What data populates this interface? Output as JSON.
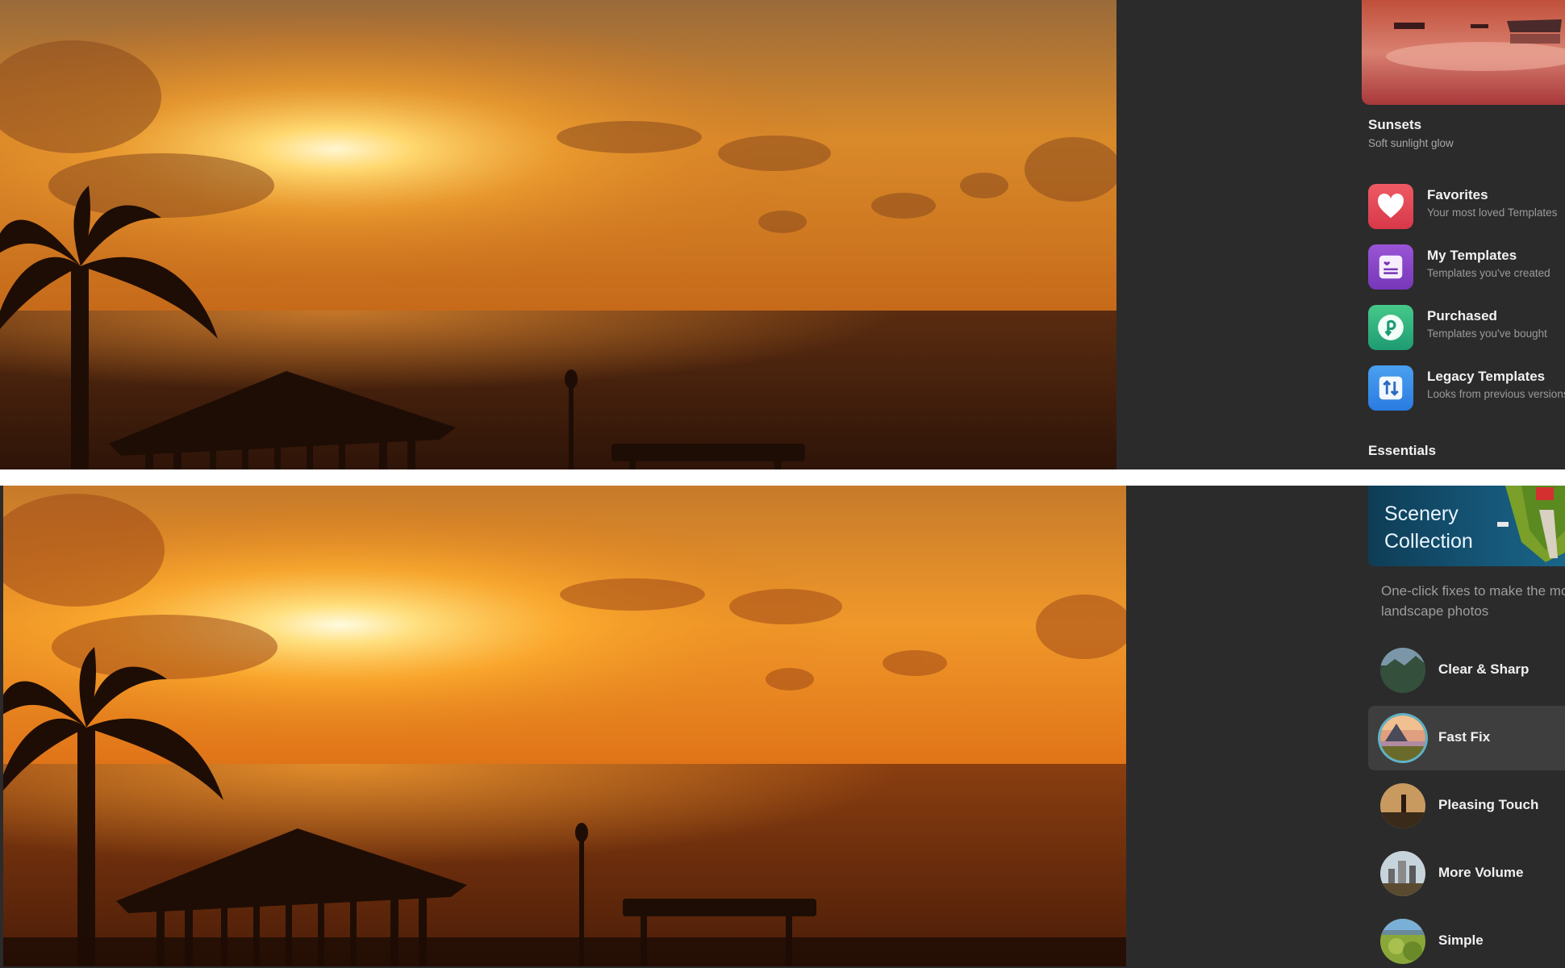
{
  "top_panel": {
    "photo": {
      "description": "Sunset over the sea with palm tree and gazebo silhouettes (before)"
    },
    "sidebar": {
      "featured_card": {
        "title": "Sunsets",
        "subtitle": "Soft sunlight glow"
      },
      "library_items": [
        {
          "title": "Favorites",
          "subtitle": "Your most loved Templates",
          "icon": "heart-icon",
          "color": "#e5464f"
        },
        {
          "title": "My Templates",
          "subtitle": "Templates you've created",
          "icon": "template-card-icon",
          "color": "#8644c7"
        },
        {
          "title": "Purchased",
          "subtitle": "Templates you've bought",
          "icon": "purchase-icon",
          "color": "#2fb47e"
        },
        {
          "title": "Legacy Templates",
          "subtitle": "Looks from previous versions",
          "icon": "swap-arrows-icon",
          "color": "#3a8ee8"
        }
      ],
      "section_title": "Essentials"
    }
  },
  "bottom_panel": {
    "photo": {
      "description": "Sunset over the sea with palm tree and gazebo silhouettes (after, warmer)"
    },
    "sidebar": {
      "collection_banner": {
        "title_line1": "Scenery",
        "title_line2": "Collection"
      },
      "collection_description_line1": "One-click fixes to make the mo",
      "collection_description_line2": "landscape photos",
      "presets": [
        {
          "label": "Clear & Sharp",
          "selected": false
        },
        {
          "label": "Fast Fix",
          "selected": true
        },
        {
          "label": "Pleasing Touch",
          "selected": false
        },
        {
          "label": "More Volume",
          "selected": false
        },
        {
          "label": "Simple",
          "selected": false
        }
      ],
      "selection_accent": "#5fb3c6"
    }
  }
}
